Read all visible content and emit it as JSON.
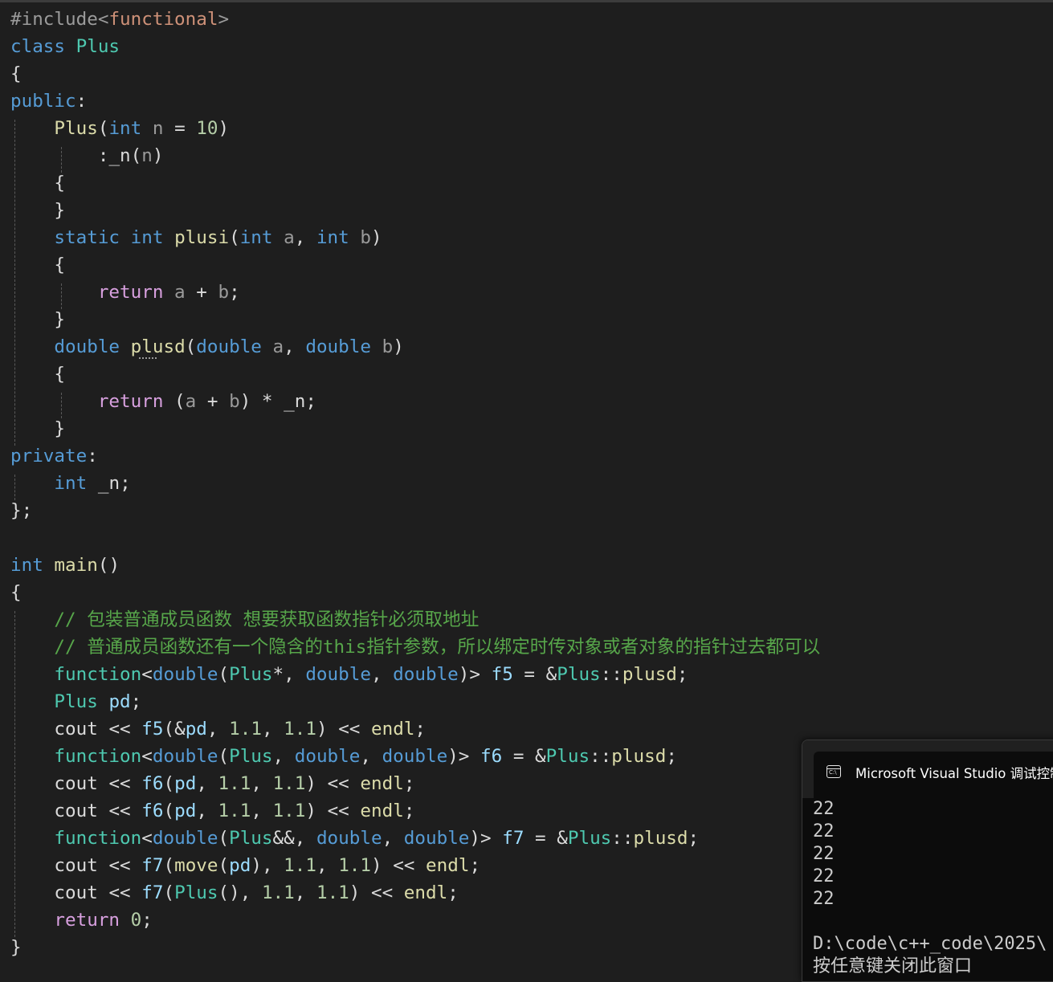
{
  "editor": {
    "lines": [
      {
        "tokens": [
          {
            "t": "#include",
            "c": "pp"
          },
          {
            "t": "<",
            "c": "pp"
          },
          {
            "t": "functional",
            "c": "str"
          },
          {
            "t": ">",
            "c": "pp"
          }
        ]
      },
      {
        "tokens": [
          {
            "t": "class ",
            "c": "kw"
          },
          {
            "t": "Plus",
            "c": "ty"
          }
        ]
      },
      {
        "tokens": [
          {
            "t": "{",
            "c": ""
          }
        ]
      },
      {
        "tokens": [
          {
            "t": "public",
            "c": "kw"
          },
          {
            "t": ":",
            "c": ""
          }
        ]
      },
      {
        "tokens": [
          {
            "t": "    ",
            "c": ""
          },
          {
            "t": "Plus",
            "c": "fn"
          },
          {
            "t": "(",
            "c": ""
          },
          {
            "t": "int",
            "c": "kw"
          },
          {
            "t": " n",
            "c": "par"
          },
          {
            "t": " = ",
            "c": ""
          },
          {
            "t": "10",
            "c": "num"
          },
          {
            "t": ")",
            "c": ""
          }
        ]
      },
      {
        "tokens": [
          {
            "t": "        :",
            "c": ""
          },
          {
            "t": "_n",
            "c": "mem"
          },
          {
            "t": "(",
            "c": ""
          },
          {
            "t": "n",
            "c": "par"
          },
          {
            "t": ")",
            "c": ""
          }
        ]
      },
      {
        "tokens": [
          {
            "t": "    {",
            "c": ""
          }
        ]
      },
      {
        "tokens": [
          {
            "t": "    }",
            "c": ""
          }
        ]
      },
      {
        "tokens": [
          {
            "t": "    ",
            "c": ""
          },
          {
            "t": "static",
            "c": "kw"
          },
          {
            "t": " ",
            "c": ""
          },
          {
            "t": "int",
            "c": "kw"
          },
          {
            "t": " ",
            "c": ""
          },
          {
            "t": "plusi",
            "c": "fn"
          },
          {
            "t": "(",
            "c": ""
          },
          {
            "t": "int",
            "c": "kw"
          },
          {
            "t": " a",
            "c": "par"
          },
          {
            "t": ", ",
            "c": ""
          },
          {
            "t": "int",
            "c": "kw"
          },
          {
            "t": " b",
            "c": "par"
          },
          {
            "t": ")",
            "c": ""
          }
        ]
      },
      {
        "tokens": [
          {
            "t": "    {",
            "c": ""
          }
        ]
      },
      {
        "tokens": [
          {
            "t": "        ",
            "c": ""
          },
          {
            "t": "return",
            "c": "ctl"
          },
          {
            "t": " a",
            "c": "par"
          },
          {
            "t": " + ",
            "c": ""
          },
          {
            "t": "b",
            "c": "par"
          },
          {
            "t": ";",
            "c": ""
          }
        ]
      },
      {
        "tokens": [
          {
            "t": "    }",
            "c": ""
          }
        ]
      },
      {
        "tokens": [
          {
            "t": "    ",
            "c": ""
          },
          {
            "t": "double",
            "c": "kw"
          },
          {
            "t": " ",
            "c": ""
          },
          {
            "t": "plusd",
            "c": "fn"
          },
          {
            "t": "(",
            "c": ""
          },
          {
            "t": "double",
            "c": "kw"
          },
          {
            "t": " a",
            "c": "par"
          },
          {
            "t": ", ",
            "c": ""
          },
          {
            "t": "double",
            "c": "kw"
          },
          {
            "t": " b",
            "c": "par"
          },
          {
            "t": ")",
            "c": ""
          }
        ]
      },
      {
        "tokens": [
          {
            "t": "    {",
            "c": ""
          }
        ]
      },
      {
        "tokens": [
          {
            "t": "        ",
            "c": ""
          },
          {
            "t": "return",
            "c": "ctl"
          },
          {
            "t": " (",
            "c": ""
          },
          {
            "t": "a",
            "c": "par"
          },
          {
            "t": " + ",
            "c": ""
          },
          {
            "t": "b",
            "c": "par"
          },
          {
            "t": ") * ",
            "c": ""
          },
          {
            "t": "_n",
            "c": "mem"
          },
          {
            "t": ";",
            "c": ""
          }
        ]
      },
      {
        "tokens": [
          {
            "t": "    }",
            "c": ""
          }
        ]
      },
      {
        "tokens": [
          {
            "t": "private",
            "c": "kw"
          },
          {
            "t": ":",
            "c": ""
          }
        ]
      },
      {
        "tokens": [
          {
            "t": "    ",
            "c": ""
          },
          {
            "t": "int",
            "c": "kw"
          },
          {
            "t": " ",
            "c": ""
          },
          {
            "t": "_n",
            "c": "mem"
          },
          {
            "t": ";",
            "c": ""
          }
        ]
      },
      {
        "tokens": [
          {
            "t": "};",
            "c": ""
          }
        ]
      },
      {
        "tokens": []
      },
      {
        "tokens": [
          {
            "t": "int",
            "c": "kw"
          },
          {
            "t": " ",
            "c": ""
          },
          {
            "t": "main",
            "c": "fn"
          },
          {
            "t": "()",
            "c": ""
          }
        ]
      },
      {
        "tokens": [
          {
            "t": "{",
            "c": ""
          }
        ]
      },
      {
        "tokens": [
          {
            "t": "    ",
            "c": ""
          },
          {
            "t": "// 包装普通成员函数 想要获取函数指针必须取地址",
            "c": "cmt"
          }
        ]
      },
      {
        "tokens": [
          {
            "t": "    ",
            "c": ""
          },
          {
            "t": "// 普通成员函数还有一个隐含的this指针参数，所以绑定时传对象或者对象的指针过去都可以",
            "c": "cmt"
          }
        ]
      },
      {
        "tokens": [
          {
            "t": "    ",
            "c": ""
          },
          {
            "t": "function",
            "c": "ty"
          },
          {
            "t": "<",
            "c": ""
          },
          {
            "t": "double",
            "c": "kw"
          },
          {
            "t": "(",
            "c": ""
          },
          {
            "t": "Plus",
            "c": "ty"
          },
          {
            "t": "*, ",
            "c": ""
          },
          {
            "t": "double",
            "c": "kw"
          },
          {
            "t": ", ",
            "c": ""
          },
          {
            "t": "double",
            "c": "kw"
          },
          {
            "t": ")> ",
            "c": ""
          },
          {
            "t": "f5",
            "c": "var"
          },
          {
            "t": " = &",
            "c": ""
          },
          {
            "t": "Plus",
            "c": "ty"
          },
          {
            "t": "::",
            "c": ""
          },
          {
            "t": "plusd",
            "c": "fn"
          },
          {
            "t": ";",
            "c": ""
          }
        ]
      },
      {
        "tokens": [
          {
            "t": "    ",
            "c": ""
          },
          {
            "t": "Plus",
            "c": "ty"
          },
          {
            "t": " ",
            "c": ""
          },
          {
            "t": "pd",
            "c": "var"
          },
          {
            "t": ";",
            "c": ""
          }
        ]
      },
      {
        "tokens": [
          {
            "t": "    ",
            "c": ""
          },
          {
            "t": "cout",
            "c": "mem"
          },
          {
            "t": " << ",
            "c": ""
          },
          {
            "t": "f5",
            "c": "var"
          },
          {
            "t": "(&",
            "c": ""
          },
          {
            "t": "pd",
            "c": "var"
          },
          {
            "t": ", ",
            "c": ""
          },
          {
            "t": "1.1",
            "c": "num"
          },
          {
            "t": ", ",
            "c": ""
          },
          {
            "t": "1.1",
            "c": "num"
          },
          {
            "t": ") << ",
            "c": ""
          },
          {
            "t": "endl",
            "c": "fn"
          },
          {
            "t": ";",
            "c": ""
          }
        ]
      },
      {
        "tokens": [
          {
            "t": "    ",
            "c": ""
          },
          {
            "t": "function",
            "c": "ty"
          },
          {
            "t": "<",
            "c": ""
          },
          {
            "t": "double",
            "c": "kw"
          },
          {
            "t": "(",
            "c": ""
          },
          {
            "t": "Plus",
            "c": "ty"
          },
          {
            "t": ", ",
            "c": ""
          },
          {
            "t": "double",
            "c": "kw"
          },
          {
            "t": ", ",
            "c": ""
          },
          {
            "t": "double",
            "c": "kw"
          },
          {
            "t": ")> ",
            "c": ""
          },
          {
            "t": "f6",
            "c": "var"
          },
          {
            "t": " = &",
            "c": ""
          },
          {
            "t": "Plus",
            "c": "ty"
          },
          {
            "t": "::",
            "c": ""
          },
          {
            "t": "plusd",
            "c": "fn"
          },
          {
            "t": ";",
            "c": ""
          }
        ]
      },
      {
        "tokens": [
          {
            "t": "    ",
            "c": ""
          },
          {
            "t": "cout",
            "c": "mem"
          },
          {
            "t": " << ",
            "c": ""
          },
          {
            "t": "f6",
            "c": "var"
          },
          {
            "t": "(",
            "c": ""
          },
          {
            "t": "pd",
            "c": "var"
          },
          {
            "t": ", ",
            "c": ""
          },
          {
            "t": "1.1",
            "c": "num"
          },
          {
            "t": ", ",
            "c": ""
          },
          {
            "t": "1.1",
            "c": "num"
          },
          {
            "t": ") << ",
            "c": ""
          },
          {
            "t": "endl",
            "c": "fn"
          },
          {
            "t": ";",
            "c": ""
          }
        ]
      },
      {
        "tokens": [
          {
            "t": "    ",
            "c": ""
          },
          {
            "t": "cout",
            "c": "mem"
          },
          {
            "t": " << ",
            "c": ""
          },
          {
            "t": "f6",
            "c": "var"
          },
          {
            "t": "(",
            "c": ""
          },
          {
            "t": "pd",
            "c": "var"
          },
          {
            "t": ", ",
            "c": ""
          },
          {
            "t": "1.1",
            "c": "num"
          },
          {
            "t": ", ",
            "c": ""
          },
          {
            "t": "1.1",
            "c": "num"
          },
          {
            "t": ") << ",
            "c": ""
          },
          {
            "t": "endl",
            "c": "fn"
          },
          {
            "t": ";",
            "c": ""
          }
        ]
      },
      {
        "tokens": [
          {
            "t": "    ",
            "c": ""
          },
          {
            "t": "function",
            "c": "ty"
          },
          {
            "t": "<",
            "c": ""
          },
          {
            "t": "double",
            "c": "kw"
          },
          {
            "t": "(",
            "c": ""
          },
          {
            "t": "Plus",
            "c": "ty"
          },
          {
            "t": "&&, ",
            "c": ""
          },
          {
            "t": "double",
            "c": "kw"
          },
          {
            "t": ", ",
            "c": ""
          },
          {
            "t": "double",
            "c": "kw"
          },
          {
            "t": ")> ",
            "c": ""
          },
          {
            "t": "f7",
            "c": "var"
          },
          {
            "t": " = &",
            "c": ""
          },
          {
            "t": "Plus",
            "c": "ty"
          },
          {
            "t": "::",
            "c": ""
          },
          {
            "t": "plusd",
            "c": "fn"
          },
          {
            "t": ";",
            "c": ""
          }
        ]
      },
      {
        "tokens": [
          {
            "t": "    ",
            "c": ""
          },
          {
            "t": "cout",
            "c": "mem"
          },
          {
            "t": " << ",
            "c": ""
          },
          {
            "t": "f7",
            "c": "var"
          },
          {
            "t": "(",
            "c": ""
          },
          {
            "t": "move",
            "c": "fn"
          },
          {
            "t": "(",
            "c": ""
          },
          {
            "t": "pd",
            "c": "var"
          },
          {
            "t": "), ",
            "c": ""
          },
          {
            "t": "1.1",
            "c": "num"
          },
          {
            "t": ", ",
            "c": ""
          },
          {
            "t": "1.1",
            "c": "num"
          },
          {
            "t": ") << ",
            "c": ""
          },
          {
            "t": "endl",
            "c": "fn"
          },
          {
            "t": ";",
            "c": ""
          }
        ]
      },
      {
        "tokens": [
          {
            "t": "    ",
            "c": ""
          },
          {
            "t": "cout",
            "c": "mem"
          },
          {
            "t": " << ",
            "c": ""
          },
          {
            "t": "f7",
            "c": "var"
          },
          {
            "t": "(",
            "c": ""
          },
          {
            "t": "Plus",
            "c": "ty"
          },
          {
            "t": "(), ",
            "c": ""
          },
          {
            "t": "1.1",
            "c": "num"
          },
          {
            "t": ", ",
            "c": ""
          },
          {
            "t": "1.1",
            "c": "num"
          },
          {
            "t": ") << ",
            "c": ""
          },
          {
            "t": "endl",
            "c": "fn"
          },
          {
            "t": ";",
            "c": ""
          }
        ]
      },
      {
        "tokens": [
          {
            "t": "    ",
            "c": ""
          },
          {
            "t": "return",
            "c": "ctl"
          },
          {
            "t": " ",
            "c": ""
          },
          {
            "t": "0",
            "c": "num"
          },
          {
            "t": ";",
            "c": ""
          }
        ]
      },
      {
        "tokens": [
          {
            "t": "}",
            "c": ""
          }
        ]
      }
    ]
  },
  "console": {
    "title": "Microsoft Visual Studio 调试控制台",
    "icon": "console-window-icon",
    "output": [
      "22",
      "22",
      "22",
      "22",
      "22",
      "",
      "D:\\code\\c++_code\\2025\\",
      "按任意键关闭此窗口"
    ]
  }
}
